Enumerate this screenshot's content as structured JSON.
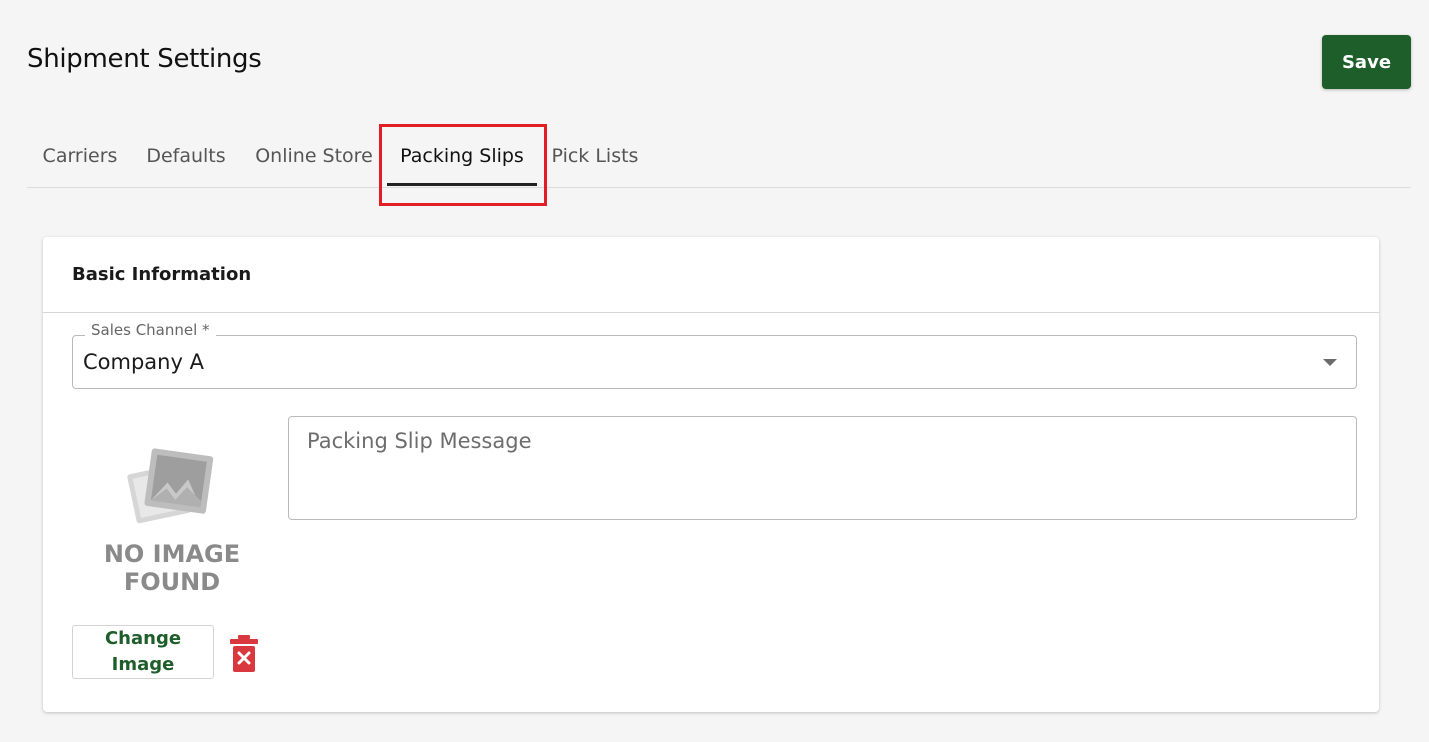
{
  "header": {
    "title": "Shipment Settings",
    "save_label": "Save"
  },
  "tabs": [
    {
      "label": "Carriers",
      "active": false
    },
    {
      "label": "Defaults",
      "active": false
    },
    {
      "label": "Online Store",
      "active": false
    },
    {
      "label": "Packing Slips",
      "active": true
    },
    {
      "label": "Pick Lists",
      "active": false
    }
  ],
  "card": {
    "title": "Basic Information",
    "sales_channel": {
      "label": "Sales Channel *",
      "value": "Company A"
    },
    "image": {
      "placeholder_line1": "NO IMAGE",
      "placeholder_line2": "FOUND",
      "change_label": "Change Image",
      "delete_icon": "trash-x-icon"
    },
    "message": {
      "placeholder": "Packing Slip Message",
      "value": ""
    }
  },
  "colors": {
    "brand": "#1e5e2a",
    "highlight": "#e21e25",
    "danger": "#d9383e"
  }
}
